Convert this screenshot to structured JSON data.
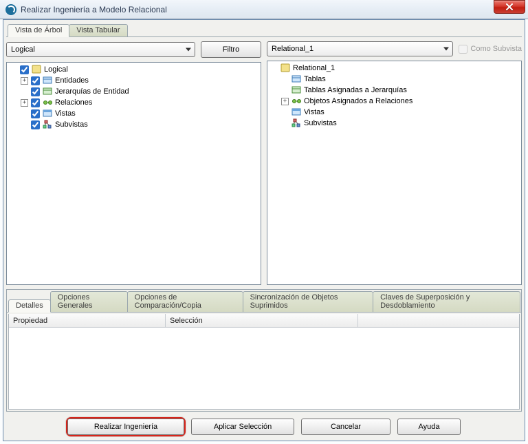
{
  "title": "Realizar Ingeniería a Modelo Relacional",
  "view_tabs": {
    "tree": "Vista de Árbol",
    "table": "Vista Tabular"
  },
  "left": {
    "combo_value": "Logical",
    "filter_btn": "Filtro",
    "tree": {
      "root": "Logical",
      "entities": "Entidades",
      "hierarchies": "Jerarquías de Entidad",
      "relations": "Relaciones",
      "views": "Vistas",
      "subviews": "Subvistas"
    }
  },
  "right": {
    "combo_value": "Relational_1",
    "subvista_label": "Como Subvista",
    "tree": {
      "root": "Relational_1",
      "tables": "Tablas",
      "tables_hier": "Tablas Asignadas a Jerarquías",
      "rel_objs": "Objetos Asignados a Relaciones",
      "views": "Vistas",
      "subviews": "Subvistas"
    }
  },
  "bottom_tabs": {
    "details": "Detalles",
    "general": "Opciones Generales",
    "compare": "Opciones de Comparación/Copia",
    "sync": "Sincronización de Objetos Suprimidos",
    "keys": "Claves de Superposición y Desdoblamiento"
  },
  "prop_table": {
    "col1": "Propiedad",
    "col2": "Selección",
    "col3": ""
  },
  "footer": {
    "engineer": "Realizar Ingeniería",
    "apply": "Aplicar Selección",
    "cancel": "Cancelar",
    "help": "Ayuda"
  }
}
